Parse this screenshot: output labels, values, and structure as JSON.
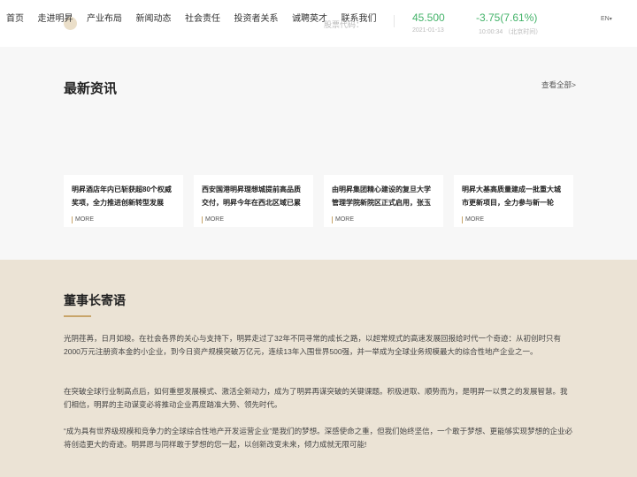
{
  "nav": {
    "items": [
      "首页",
      "走进明昇",
      "产业布局",
      "新闻动态",
      "社会责任",
      "投资者关系",
      "诚聘英才",
      "联系我们"
    ]
  },
  "stock": {
    "code_label": "股票代码：",
    "price": "45.500",
    "date": "2021-01-13",
    "change": "-3.75(7.61%)",
    "time": "10:00:34 （北京时间）"
  },
  "lang": {
    "label": "EN",
    "caret": "▾"
  },
  "news": {
    "title": "最新资讯",
    "view_all": "查看全部>",
    "cards": [
      {
        "title": "明昇酒店年内已斩获超80个权威奖项，全力推进创新转型发展",
        "more": "MORE"
      },
      {
        "title": "西安国港明昇理想城提前高品质交付，明昇今年在西北区域已累",
        "more": "MORE"
      },
      {
        "title": "由明昇集团精心建设的复旦大学管理学院新院区正式启用，张玉",
        "more": "MORE"
      },
      {
        "title": "明昇大基高质量建成一批重大城市更新项目，全力参与新一轮",
        "more": "MORE"
      }
    ]
  },
  "chairman": {
    "title": "董事长寄语",
    "paragraphs": [
      "光阴荏苒，日月如梭。在社会各界的关心与支持下，明昇走过了32年不同寻常的成长之路，以超常规式的高速发展回报给时代一个奇迹：从初创时只有2000万元注册资本金的小企业，到今日资产规模突破万亿元，连续13年入围世界500强，并一举成为全球业务规模最大的综合性地产企业之一。",
      "在突破全球行业制高点后，如何重塑发展模式、激活全新动力，成为了明昇再谋突破的关键课题。积极进取、顺势而为，是明昇一以贯之的发展智慧。我们相信，明昇的主动谋变必将推动企业再度踏准大势、领先时代。",
      "“成为具有世界级规模和竞争力的全球综合性地产开发运营企业”是我们的梦想。深感使命之重，但我们始终坚信，一个敢于梦想、更能够实现梦想的企业必将创造更大的奇迹。明昇愿与同样敢于梦想的您一起，以创新改变未来，倾力成就无限可能!"
    ]
  },
  "colors": {
    "accent": "#c8a56a",
    "stock_green": "#44b36a",
    "news_bg": "#f7f7f7",
    "chairman_bg": "#ebe3d5"
  }
}
